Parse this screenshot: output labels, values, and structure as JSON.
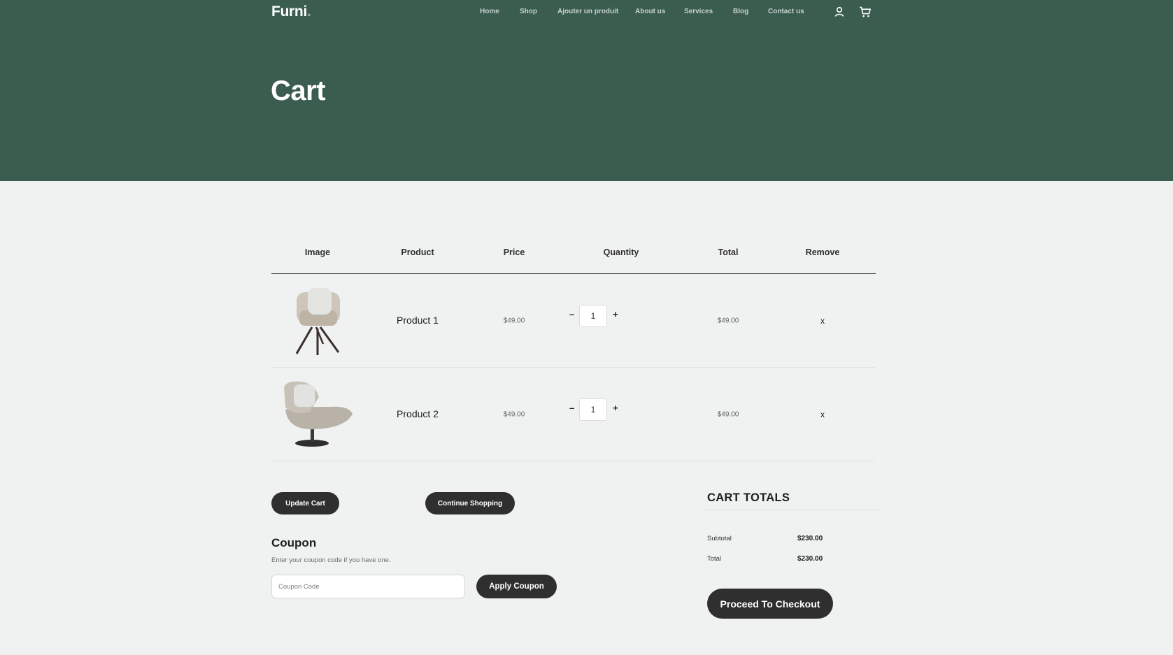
{
  "header": {
    "logo": "Furni",
    "logo_dot": ".",
    "nav": [
      "Home",
      "Shop",
      "Ajouter un produit",
      "About us",
      "Services",
      "Blog",
      "Contact us"
    ],
    "icons": [
      "user-icon",
      "cart-icon"
    ],
    "title": "Cart"
  },
  "cart_table": {
    "headers": [
      "Image",
      "Product",
      "Price",
      "Quantity",
      "Total",
      "Remove"
    ],
    "rows": [
      {
        "product": "Product 1",
        "price": "$49.00",
        "quantity": "1",
        "total": "$49.00",
        "remove": "x",
        "minus": "–",
        "plus": "+"
      },
      {
        "product": "Product 2",
        "price": "$49.00",
        "quantity": "1",
        "total": "$49.00",
        "remove": "x",
        "minus": "–",
        "plus": "+"
      }
    ]
  },
  "actions": {
    "update_cart": "Update Cart",
    "continue_shopping": "Continue Shopping"
  },
  "coupon": {
    "title": "Coupon",
    "help": "Enter your coupon code if you have one.",
    "placeholder": "Coupon Code",
    "apply": "Apply Coupon"
  },
  "totals": {
    "title": "CART TOTALS",
    "subtotal_label": "Subtotal",
    "subtotal_value": "$230.00",
    "total_label": "Total",
    "total_value": "$230.00",
    "checkout": "Proceed To Checkout"
  },
  "colors": {
    "header_bg": "#3b5d50",
    "page_bg": "#eff2f1",
    "button_bg": "#2f2f2f"
  }
}
